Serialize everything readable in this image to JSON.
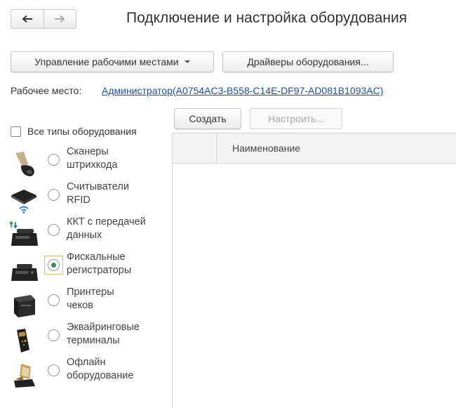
{
  "window": {
    "title": "Подключение и настройка оборудования"
  },
  "toolbar": {
    "workplaces_menu_label": "Управление рабочими местами",
    "drivers_button_label": "Драйверы оборудования..."
  },
  "workplace": {
    "label": "Рабочее место:",
    "value": "Администратор(A0754AC3-B558-C14E-DF97-AD081B1093AC)"
  },
  "equipment_types": {
    "all_types_label": "Все типы оборудования",
    "all_types_checked": false,
    "selected": "fiscal_registrars",
    "items": [
      {
        "id": "barcode_scanners",
        "label": "Сканеры\nштрихкода",
        "icon": "barcode-scanner-icon"
      },
      {
        "id": "rfid_readers",
        "label": "Считыватели\nRFID",
        "icon": "rfid-reader-icon"
      },
      {
        "id": "kkt_online",
        "label": "ККТ с передачей\nданных",
        "icon": "online-cash-register-icon"
      },
      {
        "id": "fiscal_registrars",
        "label": "Фискальные\nрегистраторы",
        "icon": "fiscal-registrar-icon"
      },
      {
        "id": "receipt_printers",
        "label": "Принтеры\nчеков",
        "icon": "receipt-printer-icon"
      },
      {
        "id": "acquiring_terminals",
        "label": "Эквайринговые\nтерминалы",
        "icon": "payment-terminal-icon"
      },
      {
        "id": "offline_equipment",
        "label": "Офлайн\nоборудование",
        "icon": "offline-equipment-icon"
      }
    ]
  },
  "list": {
    "create_label": "Создать",
    "configure_label": "Настроить...",
    "columns": [
      "Наименование"
    ],
    "rows": []
  },
  "colors": {
    "link": "#1a4fa8",
    "radio_selected": "#3a8b53",
    "focus_border": "#e0c06a"
  }
}
